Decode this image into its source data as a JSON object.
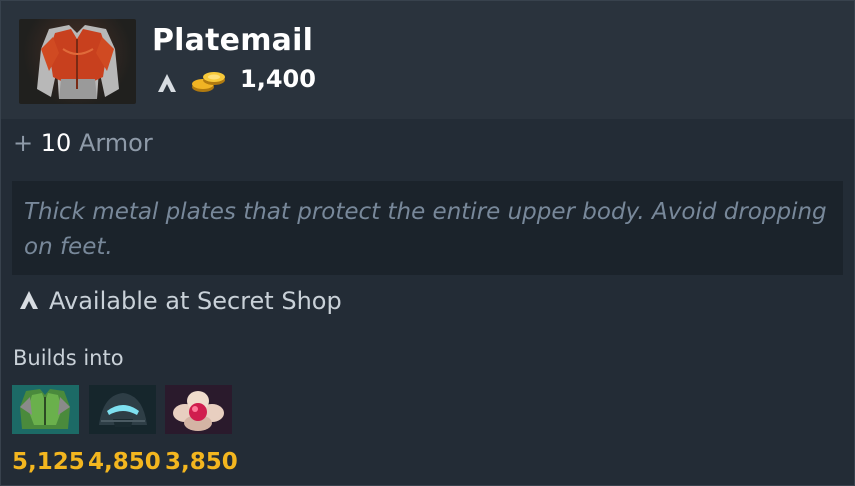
{
  "item": {
    "name": "Platemail",
    "cost": "1,400",
    "icon": "platemail-icon",
    "stat": {
      "plus": "+",
      "value": "10",
      "label": "Armor"
    },
    "lore": "Thick metal plates that protect the entire upper body. Avoid dropping on feet.",
    "availability": "Available at Secret Shop"
  },
  "builds": {
    "label": "Builds into",
    "items": [
      {
        "icon": "green-armor-icon",
        "cost": "5,125"
      },
      {
        "icon": "helm-icon",
        "cost": "4,850"
      },
      {
        "icon": "lotus-icon",
        "cost": "3,850"
      }
    ]
  },
  "colors": {
    "gold": "#f3b61f",
    "title": "#ffffff",
    "muted": "#8e9aa8",
    "lore": "#78889a"
  }
}
